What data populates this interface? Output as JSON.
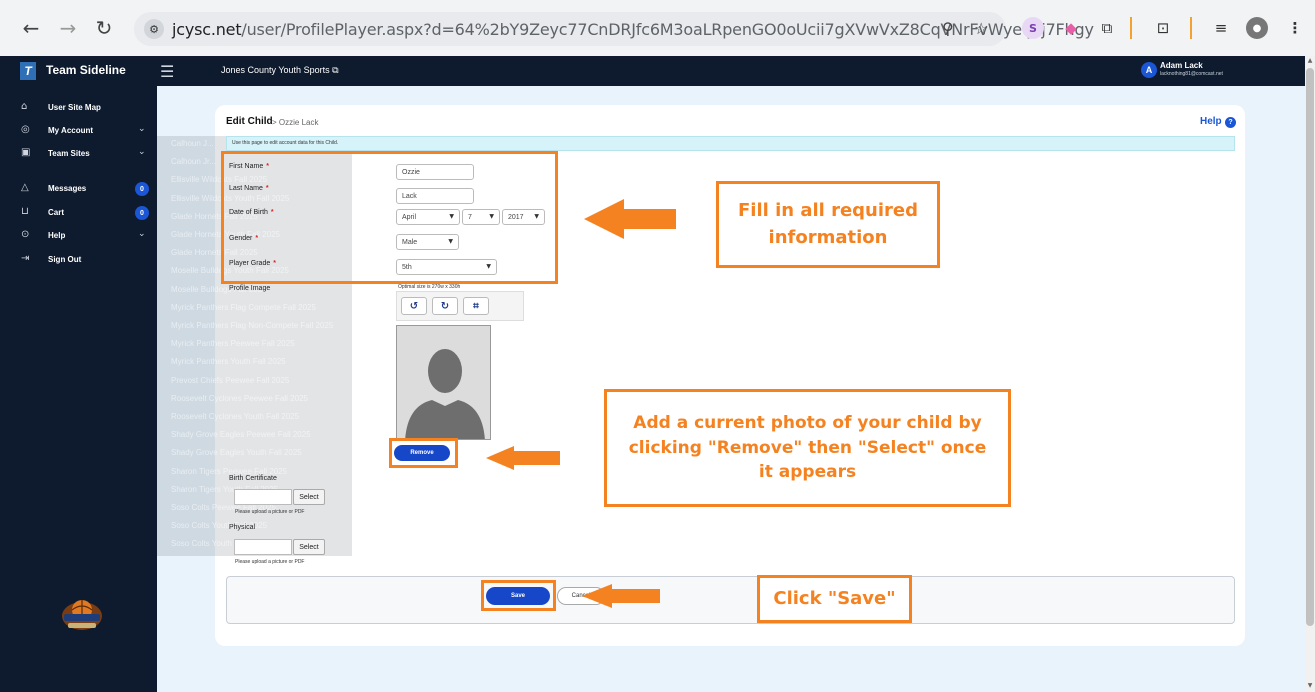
{
  "browser": {
    "url_host": "jcysc.net",
    "url_path": "/user/ProfilePlayer.aspx?d=64%2bY9Zeyc77CnDRJfc6M3oaLRpenGO0oUcii7gXVwVxZ8CqVNrFvWyetjkj7Fhgy",
    "ext_s_label": "S"
  },
  "app": {
    "brand": "Team Sideline",
    "org_name": "Jones County Youth Sports",
    "user_initial": "A",
    "user_name": "Adam Lack",
    "user_email": "lacknothing81@comcast.net"
  },
  "sidebar": {
    "items": [
      {
        "label": "User Site Map"
      },
      {
        "label": "My Account"
      },
      {
        "label": "Team Sites"
      },
      {
        "label": "Messages",
        "badge": "0"
      },
      {
        "label": "Cart",
        "badge": "0"
      },
      {
        "label": "Help"
      },
      {
        "label": "Sign Out"
      }
    ],
    "logo_text": "JONES COUNTY YOUTH SPORTS"
  },
  "ghost_list": [
    "Calhoun J...",
    "Calhoun Jr...",
    "Ellisville Wildcats Fall 2025",
    "Ellisville Wildcats Youth Fall 2025",
    "Glade Hornets Fall 2025",
    "Glade Hornets Youth Fall 2025",
    "Glade Hornets Fall 2025",
    "Moselle Bulldogs Youth Fall 2025",
    "Moselle Bulldogs Fall 2025",
    "Myrick Panthers Flag Compete Fall 2025",
    "Myrick Panthers Flag Non-Compete Fall 2025",
    "Myrick Panthers Peewee Fall 2025",
    "Myrick Panthers Youth Fall 2025",
    "Prevost Chiefs Peewee Fall 2025",
    "Roosevelt Cyclones Peewee Fall 2025",
    "Roosevelt Cyclones Youth Fall 2025",
    "Shady Grove Eagles Peewee Fall 2025",
    "Shady Grove Eagles Youth Fall 2025",
    "Sharon Tigers Peewee Fall 2025",
    "Sharon Tigers Youth Fall 2025",
    "Soso Colts Peewee Fall 2025",
    "Soso Colts Youth Fall 2025",
    "Soso Colts Youth Fall 2025"
  ],
  "form": {
    "title": "Edit Child",
    "crumb": "> Ozzie Lack",
    "help": "Help",
    "help_icon": "?",
    "info": "Use this page to edit account data for this Child.",
    "first_name_label": "First Name",
    "first_name_value": "Ozzie",
    "last_name_label": "Last Name",
    "last_name_value": "Lack",
    "dob_label": "Date of Birth",
    "dob_month": "April",
    "dob_day": "7",
    "dob_year": "2017",
    "gender_label": "Gender",
    "gender_value": "Male",
    "grade_label": "Player Grade",
    "grade_value": "5th",
    "profile_image_label": "Profile Image",
    "image_note": "Optimal size is 270w x 330h",
    "remove_label": "Remove",
    "birth_cert_label": "Birth Certificate",
    "physical_label": "Physical",
    "select_label": "Select",
    "upload_note": "Please upload a picture or PDF",
    "save_label": "Save",
    "cancel_label": "Cancel"
  },
  "annotations": {
    "fill_required": "Fill in all required information",
    "add_photo": "Add a current photo of your child by clicking \"Remove\" then \"Select\" once it appears",
    "click_save": "Click \"Save\""
  },
  "colors": {
    "accent_orange": "#f58220",
    "brand_navy": "#0e1b2e",
    "button_blue": "#1747c9"
  }
}
